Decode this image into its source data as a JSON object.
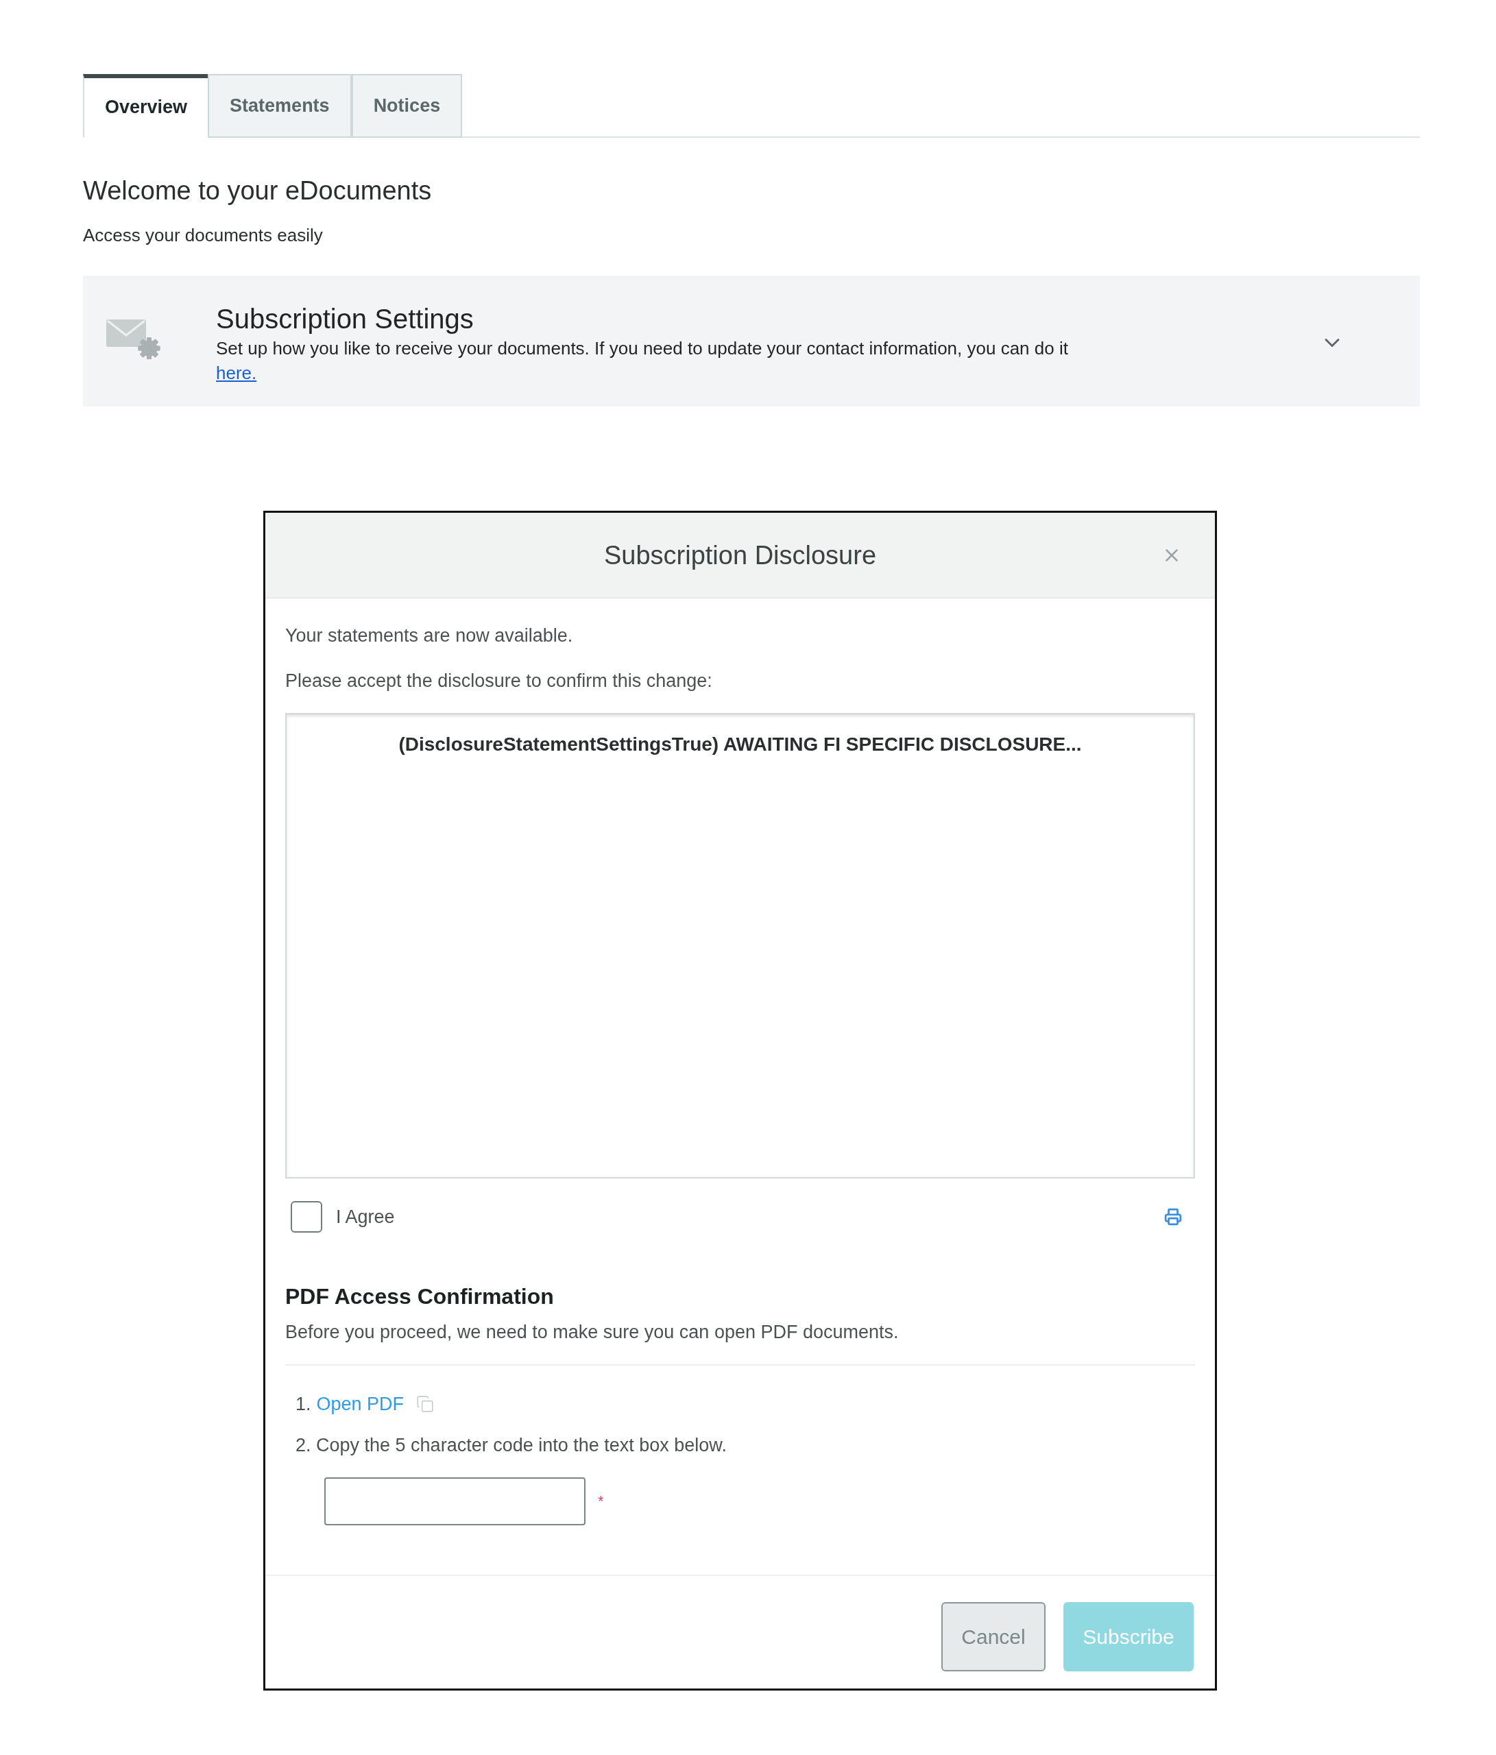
{
  "tabs": [
    {
      "label": "Overview",
      "selected": true
    },
    {
      "label": "Statements",
      "selected": false
    },
    {
      "label": "Notices",
      "selected": false
    }
  ],
  "welcome": {
    "title": "Welcome to your eDocuments",
    "subtitle": "Access your documents easily"
  },
  "subscription_settings": {
    "title": "Subscription Settings",
    "description": "Set up how you like to receive your documents. If you need to update your contact information, you can do it",
    "link": "here.",
    "expanded": false
  },
  "dialog": {
    "title": "Subscription Disclosure",
    "messages": [
      "Your statements are now available.",
      "Please accept the disclosure to confirm this change:"
    ],
    "disclosure": "(DisclosureStatementSettingsTrue) AWAITING FI SPECIFIC DISCLOSURE...",
    "agree": {
      "label": "I Agree",
      "checked": false
    },
    "pdf_access": {
      "title": "PDF Access Confirmation",
      "description": "Before you proceed, we need to make sure you can open PDF documents.",
      "steps": [
        {
          "kind": "link",
          "number": "1.",
          "text": "Open PDF"
        },
        {
          "kind": "text",
          "number": "2.",
          "text": "Copy the 5 character code into the text box below."
        }
      ],
      "code_field": {
        "required_mark": "*"
      }
    },
    "buttons": [
      {
        "kind": "secondary",
        "label": "Cancel",
        "disabled": false
      },
      {
        "kind": "primary",
        "label": "Subscribe",
        "disabled": true
      }
    ]
  }
}
